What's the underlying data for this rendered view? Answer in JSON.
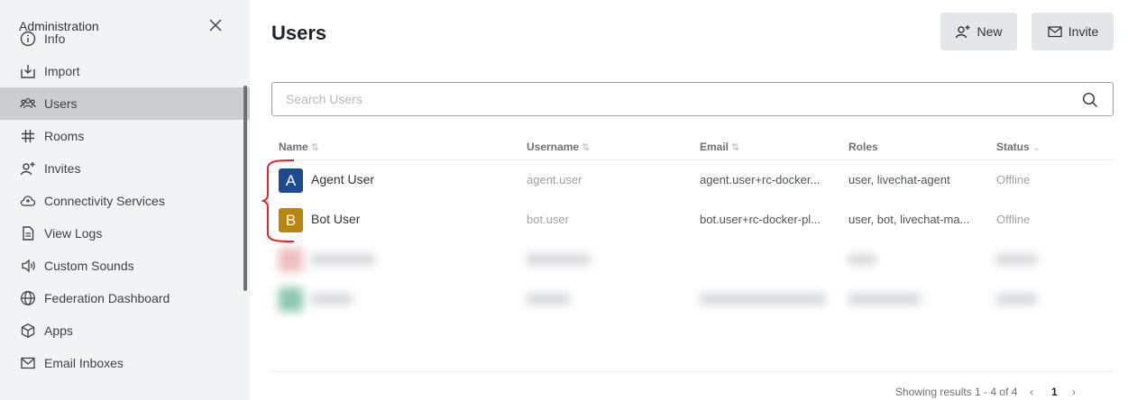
{
  "sidebar": {
    "title": "Administration",
    "items": [
      {
        "label": "Info",
        "icon": "info-icon"
      },
      {
        "label": "Import",
        "icon": "import-icon"
      },
      {
        "label": "Users",
        "icon": "users-icon",
        "active": true
      },
      {
        "label": "Rooms",
        "icon": "hashtag-icon"
      },
      {
        "label": "Invites",
        "icon": "user-plus-icon"
      },
      {
        "label": "Connectivity Services",
        "icon": "cloud-icon"
      },
      {
        "label": "View Logs",
        "icon": "file-icon"
      },
      {
        "label": "Custom Sounds",
        "icon": "speaker-icon"
      },
      {
        "label": "Federation Dashboard",
        "icon": "globe-icon"
      },
      {
        "label": "Apps",
        "icon": "cube-icon"
      },
      {
        "label": "Email Inboxes",
        "icon": "mail-icon"
      }
    ]
  },
  "header": {
    "title": "Users",
    "new_label": "New",
    "invite_label": "Invite"
  },
  "search": {
    "placeholder": "Search Users"
  },
  "table": {
    "columns": {
      "name": "Name",
      "username": "Username",
      "email": "Email",
      "roles": "Roles",
      "status": "Status"
    },
    "rows": [
      {
        "initial": "A",
        "avatar_color": "#1d4b91",
        "name": "Agent User",
        "username": "agent.user",
        "email": "agent.user+rc-docker...",
        "roles": "user, livechat-agent",
        "status": "Offline"
      },
      {
        "initial": "B",
        "avatar_color": "#b7860b",
        "name": "Bot User",
        "username": "bot.user",
        "email": "bot.user+rc-docker-pl...",
        "roles": "user, bot, livechat-ma...",
        "status": "Offline"
      }
    ]
  },
  "pagination": {
    "summary": "Showing results 1 - 4 of 4",
    "current_page": "1"
  },
  "colors": {
    "highlight_bracket": "#e0262b",
    "sidebar_bg": "#f2f3f5",
    "active_item_bg": "#cbced1"
  }
}
